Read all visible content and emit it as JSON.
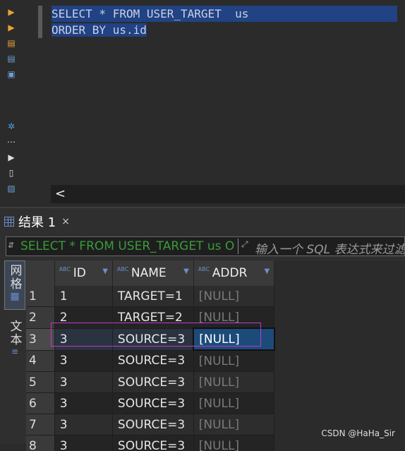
{
  "editor": {
    "lines": [
      {
        "text": "SELECT * FROM USER_TARGET  us"
      },
      {
        "text": "ORDER BY us.id"
      }
    ],
    "scroll_left_glyph": "<"
  },
  "results": {
    "tab_label": "结果 1",
    "tab_close": "×",
    "filter": {
      "sql_text": "SELECT * FROM USER_TARGET us O",
      "placeholder": "输入一个 SQL 表达式来过滤"
    },
    "side_tabs": {
      "grid_label": "网格",
      "text_label": "文本"
    },
    "columns": [
      {
        "type_badge": "ABC",
        "name": "ID"
      },
      {
        "type_badge": "ABC",
        "name": "NAME"
      },
      {
        "type_badge": "ABC",
        "name": "ADDR"
      }
    ],
    "rows": [
      {
        "num": "1",
        "id": "1",
        "name": "TARGET=1",
        "addr": "[NULL]"
      },
      {
        "num": "2",
        "id": "2",
        "name": "TARGET=2",
        "addr": "[NULL]"
      },
      {
        "num": "3",
        "id": "3",
        "name": "SOURCE=3",
        "addr": "[NULL]"
      },
      {
        "num": "4",
        "id": "3",
        "name": "SOURCE=3",
        "addr": "[NULL]"
      },
      {
        "num": "5",
        "id": "3",
        "name": "SOURCE=3",
        "addr": "[NULL]"
      },
      {
        "num": "6",
        "id": "3",
        "name": "SOURCE=3",
        "addr": "[NULL]"
      },
      {
        "num": "7",
        "id": "3",
        "name": "SOURCE=3",
        "addr": "[NULL]"
      },
      {
        "num": "8",
        "id": "3",
        "name": "SOURCE=3",
        "addr": "[NULL]"
      }
    ]
  },
  "watermark": "CSDN @HaHa_Sir",
  "colors": {
    "selection": "#214283",
    "focus_cell": "#1c4b7a",
    "highlight_box": "#c03ac6",
    "filter_sql": "#3a9a3a"
  }
}
